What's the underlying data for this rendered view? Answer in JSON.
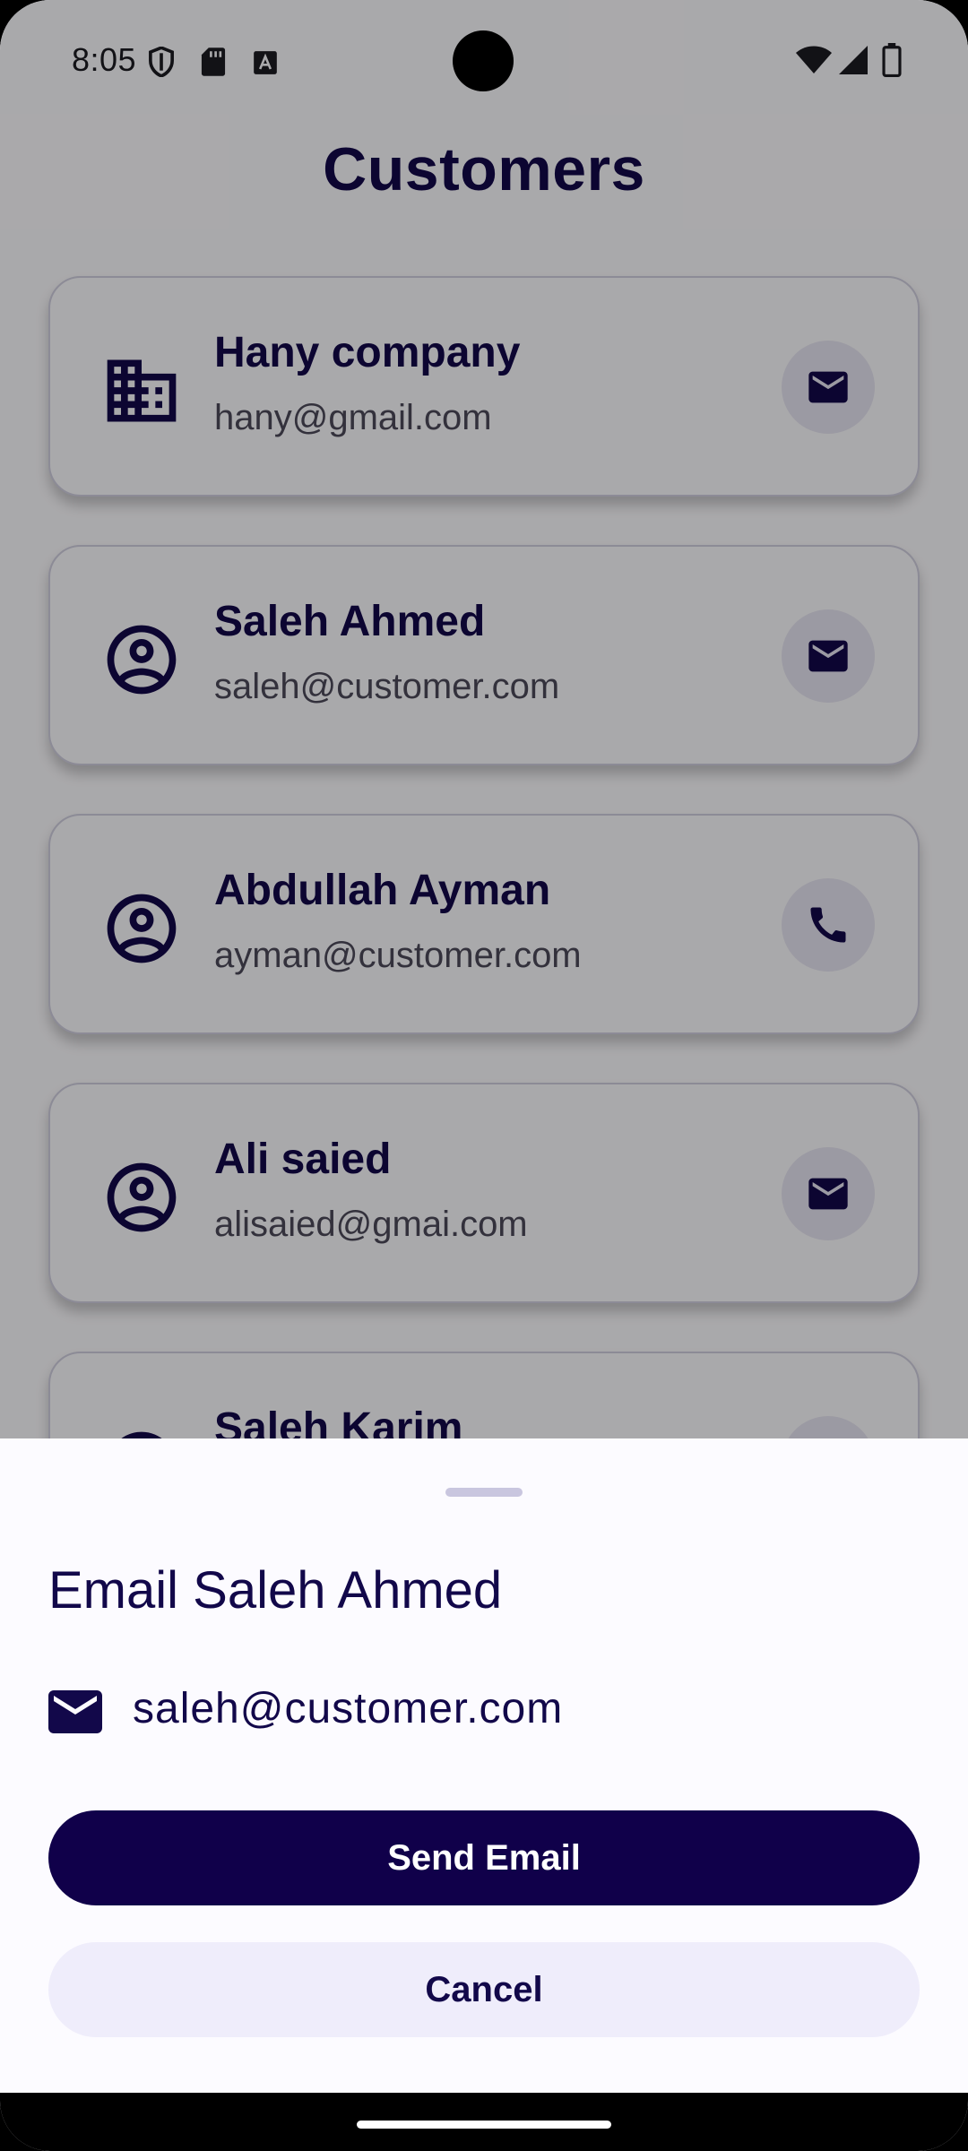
{
  "status_bar": {
    "time": "8:05"
  },
  "page": {
    "title": "Customers"
  },
  "customers": [
    {
      "name": "Hany company",
      "email": "hany@gmail.com",
      "avatar_icon": "business-icon",
      "action_icon": "mail-icon"
    },
    {
      "name": "Saleh Ahmed",
      "email": "saleh@customer.com",
      "avatar_icon": "account-circle-icon",
      "action_icon": "mail-icon"
    },
    {
      "name": "Abdullah Ayman",
      "email": "ayman@customer.com",
      "avatar_icon": "account-circle-icon",
      "action_icon": "phone-icon"
    },
    {
      "name": "Ali saied",
      "email": "alisaied@gmai.com",
      "avatar_icon": "account-circle-icon",
      "action_icon": "mail-icon"
    },
    {
      "name": "Saleh Karim",
      "email": "",
      "avatar_icon": "account-circle-icon",
      "action_icon": ""
    }
  ],
  "sheet": {
    "title": "Email Saleh Ahmed",
    "email": "saleh@customer.com",
    "email_icon": "mail-icon",
    "send_label": "Send Email",
    "cancel_label": "Cancel"
  },
  "colors": {
    "primary": "#10004a",
    "title_text": "#12084a",
    "secondary_button": "#efedfb",
    "icon_badge": "#e8e6f3",
    "scrim": "rgba(0,0,0,0.33)"
  }
}
